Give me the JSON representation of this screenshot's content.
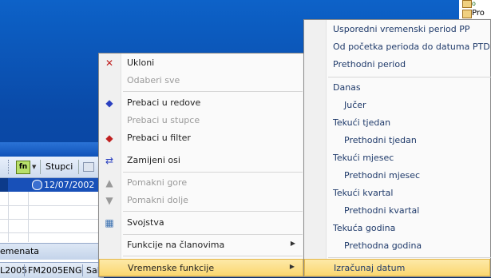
{
  "tree": {
    "item_label": "Pro"
  },
  "grid": {
    "fn_label": "fn",
    "columns_label": "Stupci",
    "date_value": "12/07/2002",
    "tab_label": "emenata"
  },
  "status_bar": {
    "items": [
      "L2005",
      "FM2005ENG",
      "Sal"
    ]
  },
  "context_menu": {
    "items": [
      {
        "label": "Ukloni",
        "icon": "remove-x-icon",
        "disabled": false
      },
      {
        "label": "Odaberi sve",
        "icon": "",
        "disabled": true
      },
      {
        "label": "Prebaci u redove",
        "icon": "move-to-rows-icon",
        "disabled": false
      },
      {
        "label": "Prebaci u stupce",
        "icon": "",
        "disabled": true
      },
      {
        "label": "Prebaci u filter",
        "icon": "move-to-filter-icon",
        "disabled": false
      },
      {
        "label": "Zamijeni osi",
        "icon": "swap-axes-icon",
        "disabled": false
      },
      {
        "label": "Pomakni gore",
        "icon": "move-up-icon",
        "disabled": true
      },
      {
        "label": "Pomakni dolje",
        "icon": "move-down-icon",
        "disabled": true
      },
      {
        "label": "Svojstva",
        "icon": "properties-icon",
        "disabled": false
      },
      {
        "label": "Funkcije na članovima",
        "icon": "",
        "disabled": false,
        "submenu": true
      },
      {
        "label": "Vremenske funkcije",
        "icon": "",
        "disabled": false,
        "submenu": true,
        "highlighted": true
      }
    ]
  },
  "time_submenu": {
    "items": [
      {
        "label": "Usporedni vremenski period PP"
      },
      {
        "label": "Od početka perioda do datuma PTD"
      },
      {
        "label": "Prethodni period"
      },
      {
        "label": "Danas"
      },
      {
        "label": "Jučer"
      },
      {
        "label": "Tekući tjedan"
      },
      {
        "label": "Prethodni tjedan"
      },
      {
        "label": "Tekući mjesec"
      },
      {
        "label": "Prethodni mjesec"
      },
      {
        "label": "Tekući kvartal"
      },
      {
        "label": "Prethodni kvartal"
      },
      {
        "label": "Tekuća godina"
      },
      {
        "label": "Prethodna godina"
      },
      {
        "label": "Izračunaj datum",
        "highlighted": true
      }
    ]
  },
  "colors": {
    "accent_highlight": "#fbd770",
    "background_blue": "#0a3f99"
  }
}
